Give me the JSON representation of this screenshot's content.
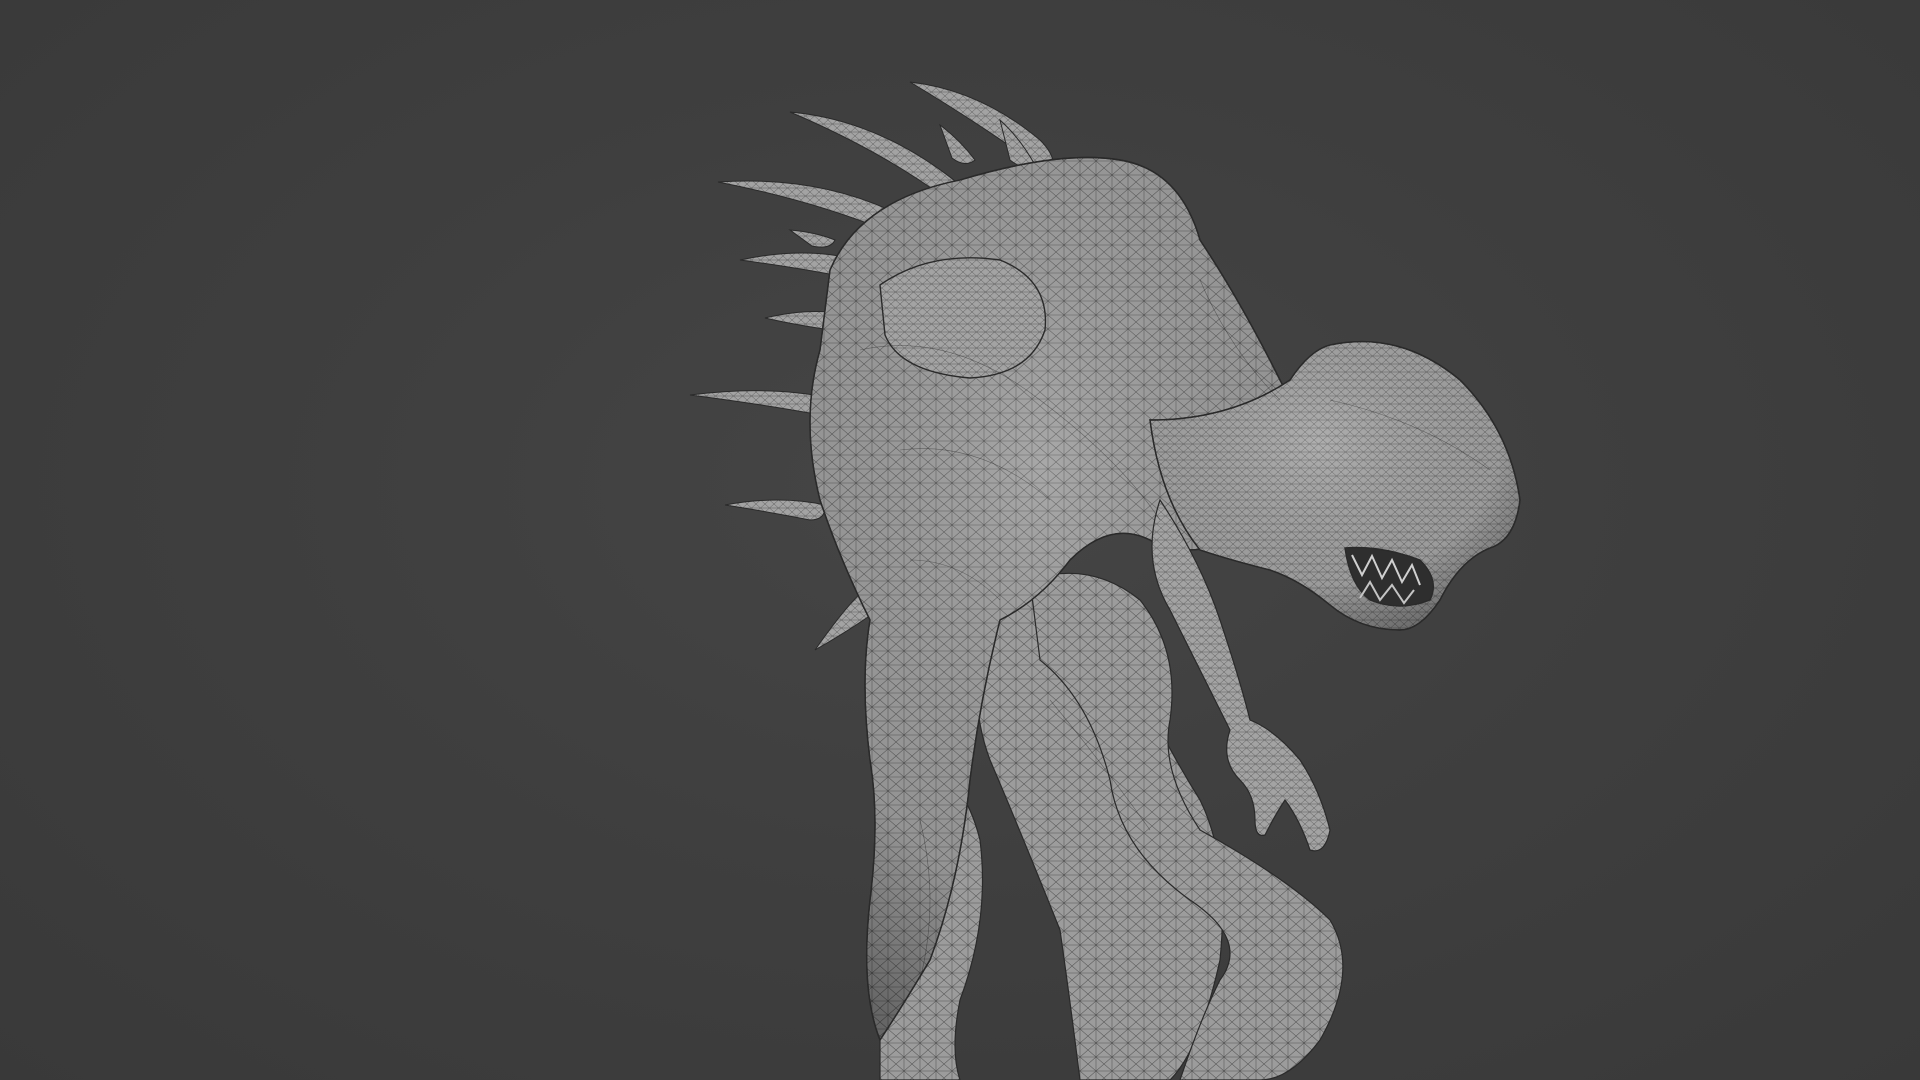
{
  "viewport": {
    "background_color": "#3d3d3d",
    "shading": "solid-wireframe",
    "object": {
      "kind": "sculpt-mesh",
      "mesh_color": "#9a9a9a",
      "wire_color": "#1a1a1a"
    }
  }
}
